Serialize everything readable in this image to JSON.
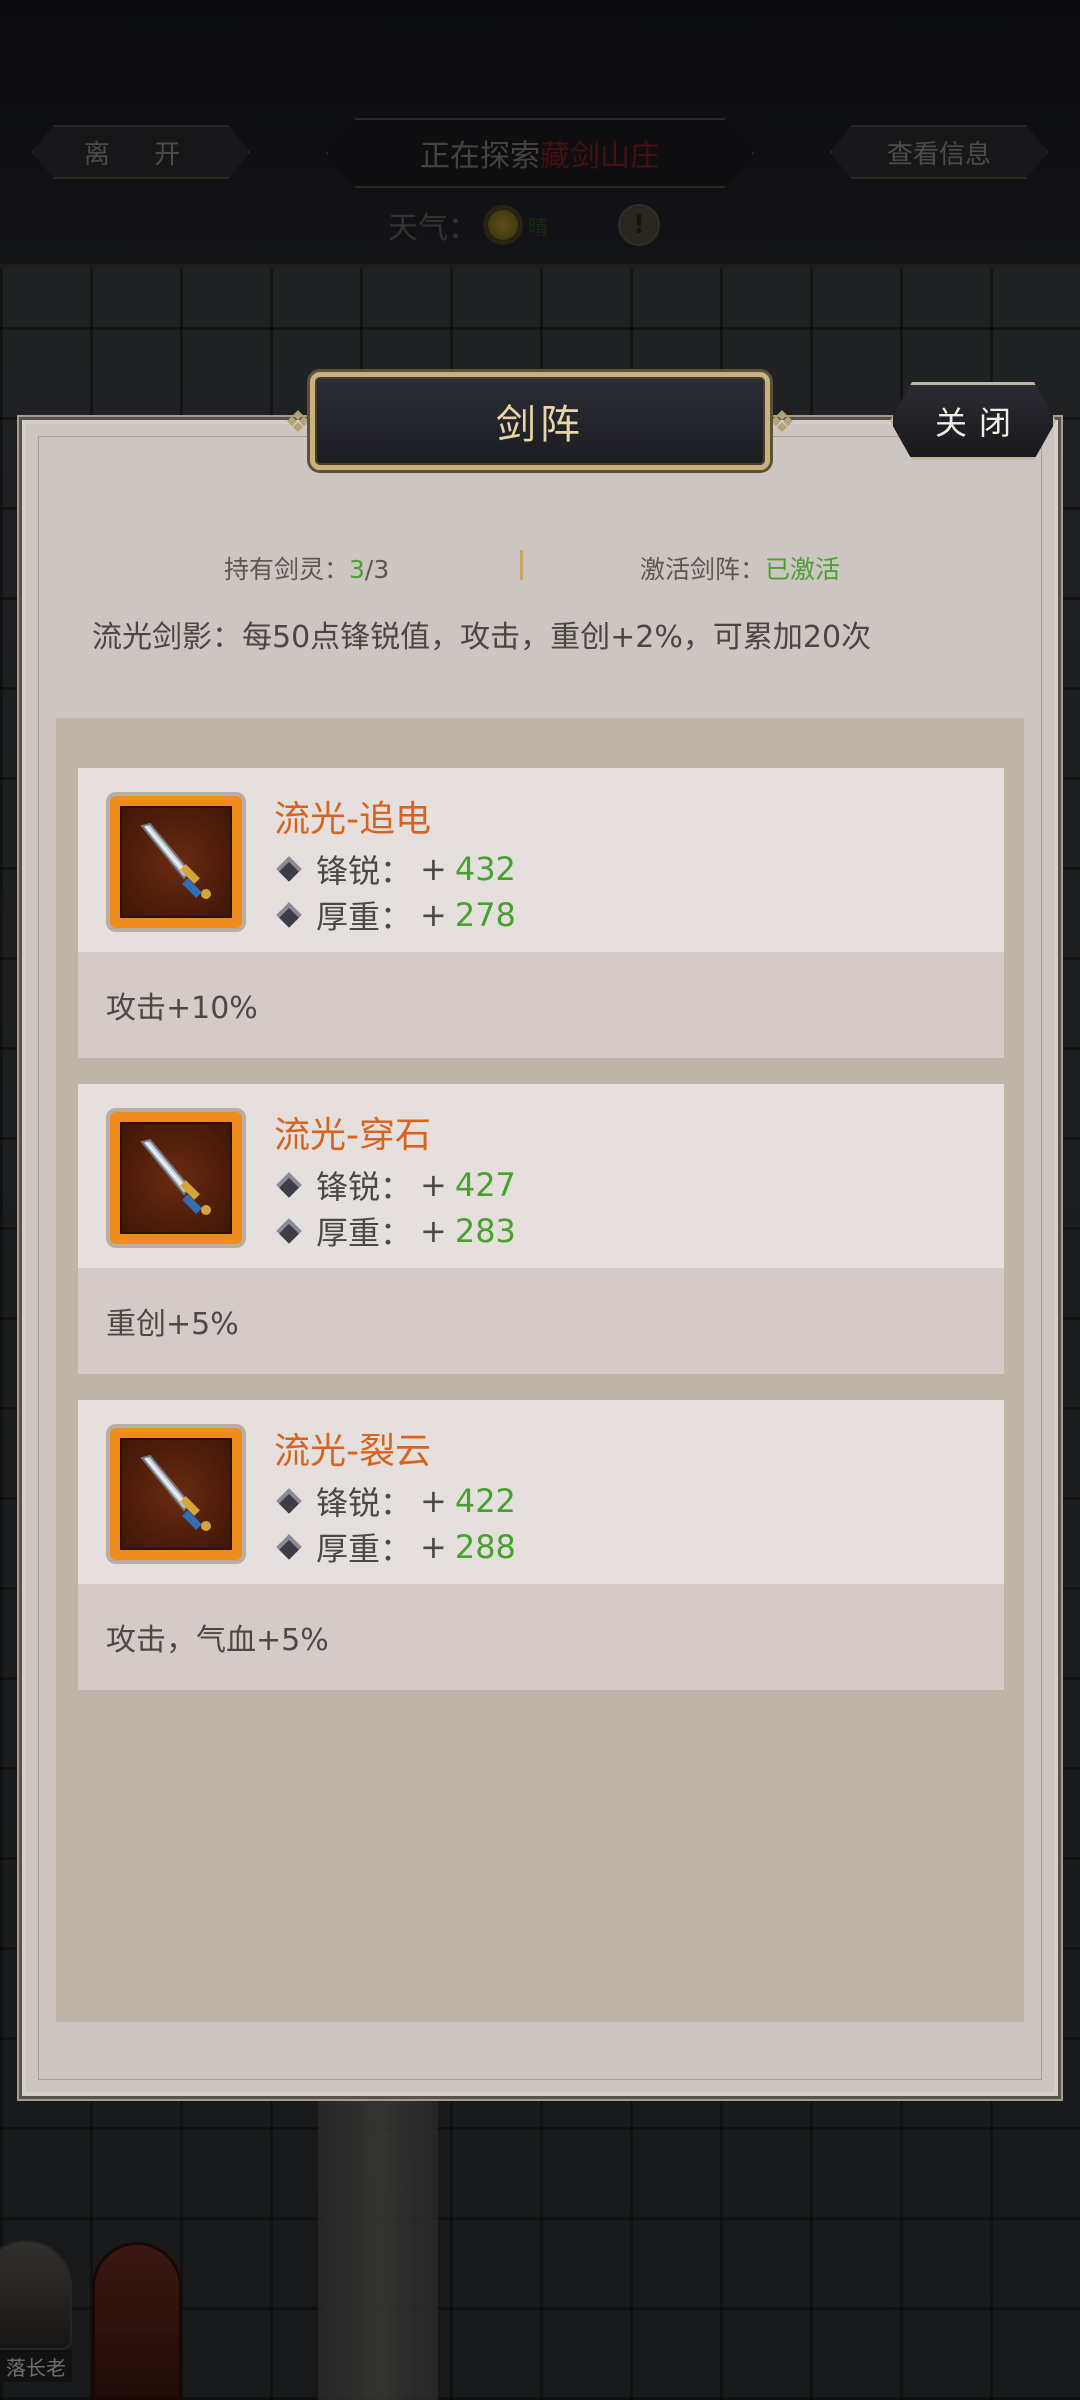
{
  "topbar": {
    "leave_label": "离 开",
    "explore_prefix": "正在探索",
    "explore_place": "藏剑山庄",
    "info_label": "查看信息",
    "weather_label": "天气：",
    "weather_value": "晴"
  },
  "map": {
    "elder_label": "落长老"
  },
  "panel": {
    "title": "剑阵",
    "close_label": "关闭",
    "held_label": "持有剑灵：",
    "held_current": "3",
    "held_total": "/3",
    "active_label": "激活剑阵：",
    "active_value": "已激活",
    "effect": "流光剑影：每50点锋锐值，攻击，重创+2%，可累加20次"
  },
  "cards": [
    {
      "name": "流光-追电",
      "attr1_label": "锋锐：",
      "attr1_sign": "+",
      "attr1_value": "432",
      "attr2_label": "厚重：",
      "attr2_sign": "+",
      "attr2_value": "278",
      "bonus": "攻击+10%"
    },
    {
      "name": "流光-穿石",
      "attr1_label": "锋锐：",
      "attr1_sign": "+",
      "attr1_value": "427",
      "attr2_label": "厚重：",
      "attr2_sign": "+",
      "attr2_value": "283",
      "bonus": "重创+5%"
    },
    {
      "name": "流光-裂云",
      "attr1_label": "锋锐：",
      "attr1_sign": "+",
      "attr1_value": "422",
      "attr2_label": "厚重：",
      "attr2_sign": "+",
      "attr2_value": "288",
      "bonus": "攻击，气血+5%"
    }
  ],
  "colors": {
    "accent_orange": "#d8631e",
    "value_green": "#47a12e",
    "frame_orange": "#f08b1e"
  }
}
